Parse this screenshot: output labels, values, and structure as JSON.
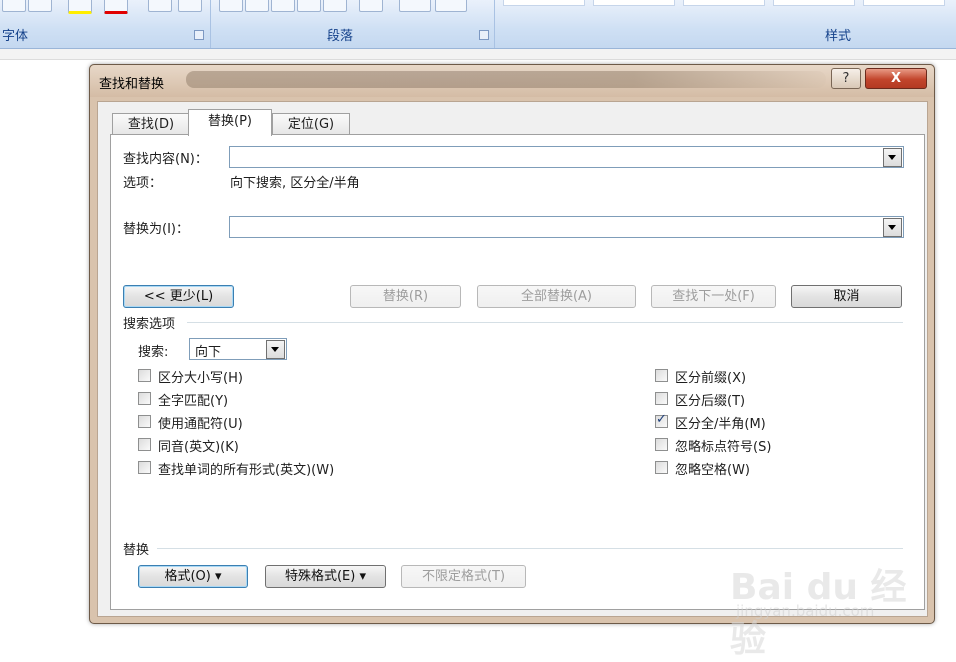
{
  "ribbon": {
    "groups": [
      {
        "label": "字体"
      },
      {
        "label": "段落"
      },
      {
        "label": "样式"
      }
    ]
  },
  "dialog": {
    "title": "查找和替换",
    "help": "?",
    "close": "X",
    "tabs": [
      {
        "label": "查找(D)",
        "key": "D",
        "active": false
      },
      {
        "label": "替换(P)",
        "key": "P",
        "active": true
      },
      {
        "label": "定位(G)",
        "key": "G",
        "active": false
      }
    ],
    "find": {
      "label": "查找内容(N)：",
      "value": ""
    },
    "options": {
      "label": "选项：",
      "value": "向下搜索, 区分全/半角"
    },
    "replace": {
      "label": "替换为(I)：",
      "value": ""
    },
    "buttons": {
      "less": "<< 更少(L)",
      "replace": "替换(R)",
      "replace_all": "全部替换(A)",
      "find_next": "查找下一处(F)",
      "cancel": "取消"
    },
    "search_options": {
      "heading": "搜索选项",
      "search_label": "搜索:",
      "search_value": "向下",
      "left": [
        {
          "label": "区分大小写(H)",
          "checked": false
        },
        {
          "label": "全字匹配(Y)",
          "checked": false
        },
        {
          "label": "使用通配符(U)",
          "checked": false
        },
        {
          "label": "同音(英文)(K)",
          "checked": false
        },
        {
          "label": "查找单词的所有形式(英文)(W)",
          "checked": false
        }
      ],
      "right": [
        {
          "label": "区分前缀(X)",
          "checked": false
        },
        {
          "label": "区分后缀(T)",
          "checked": false
        },
        {
          "label": "区分全/半角(M)",
          "checked": true
        },
        {
          "label": "忽略标点符号(S)",
          "checked": false
        },
        {
          "label": "忽略空格(W)",
          "checked": false
        }
      ]
    },
    "replace_section": {
      "heading": "替换",
      "format": "格式(O) ▾",
      "special": "特殊格式(E) ▾",
      "no_format": "不限定格式(T)"
    }
  },
  "watermark": {
    "brand": "Bai du 经验",
    "url": "jingyan.baidu.com"
  }
}
